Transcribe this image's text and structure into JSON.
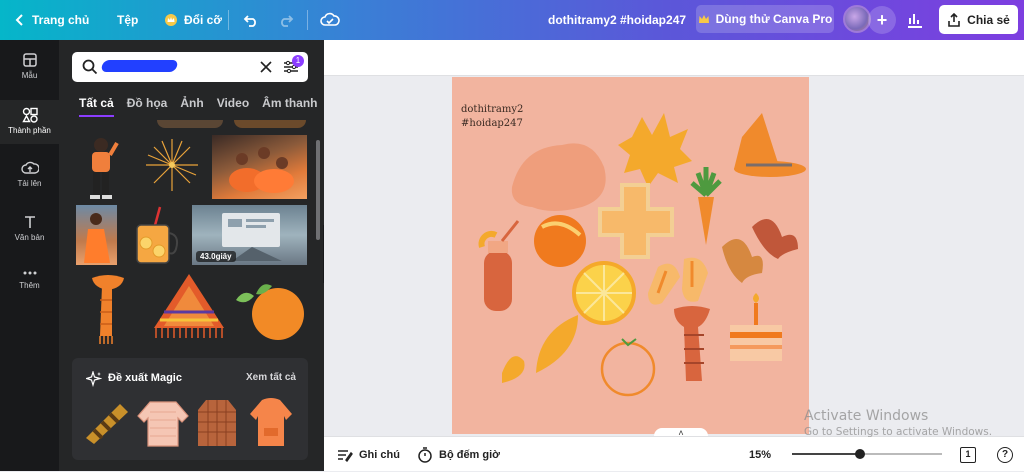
{
  "topbar": {
    "home": "Trang chủ",
    "file": "Tệp",
    "resize": "Đổi cỡ",
    "doc_title": "dothitramy2 #hoidap247",
    "trial": "Dùng thử Canva Pro",
    "share": "Chia sẻ"
  },
  "rail": [
    {
      "label": "Mẫu",
      "icon": "template-icon"
    },
    {
      "label": "Thành phần",
      "icon": "elements-icon"
    },
    {
      "label": "Tải lên",
      "icon": "upload-icon"
    },
    {
      "label": "Văn bản",
      "icon": "text-icon"
    },
    {
      "label": "Thêm",
      "icon": "more-icon"
    }
  ],
  "panel": {
    "filter_badge": "1",
    "tabs": [
      "Tất cả",
      "Đồ họa",
      "Ảnh",
      "Video",
      "Âm thanh"
    ],
    "video_duration": "43.0giây",
    "magic_title": "Đề xuất Magic",
    "magic_all": "Xem tất cả"
  },
  "canvas": {
    "line1": "dothitramy2",
    "line2": "#hoidap247"
  },
  "bottombar": {
    "notes": "Ghi chú",
    "timer": "Bộ đếm giờ",
    "zoom": "15%",
    "zoom_level": 0.15,
    "page_count": "1",
    "help": "?"
  },
  "watermark": {
    "line1": "Activate Windows",
    "line2": "Go to Settings to activate Windows."
  },
  "colors": {
    "canvas_bg": "#f2b49f",
    "accent": "#8b3dff",
    "orange": "#f08a2c"
  }
}
